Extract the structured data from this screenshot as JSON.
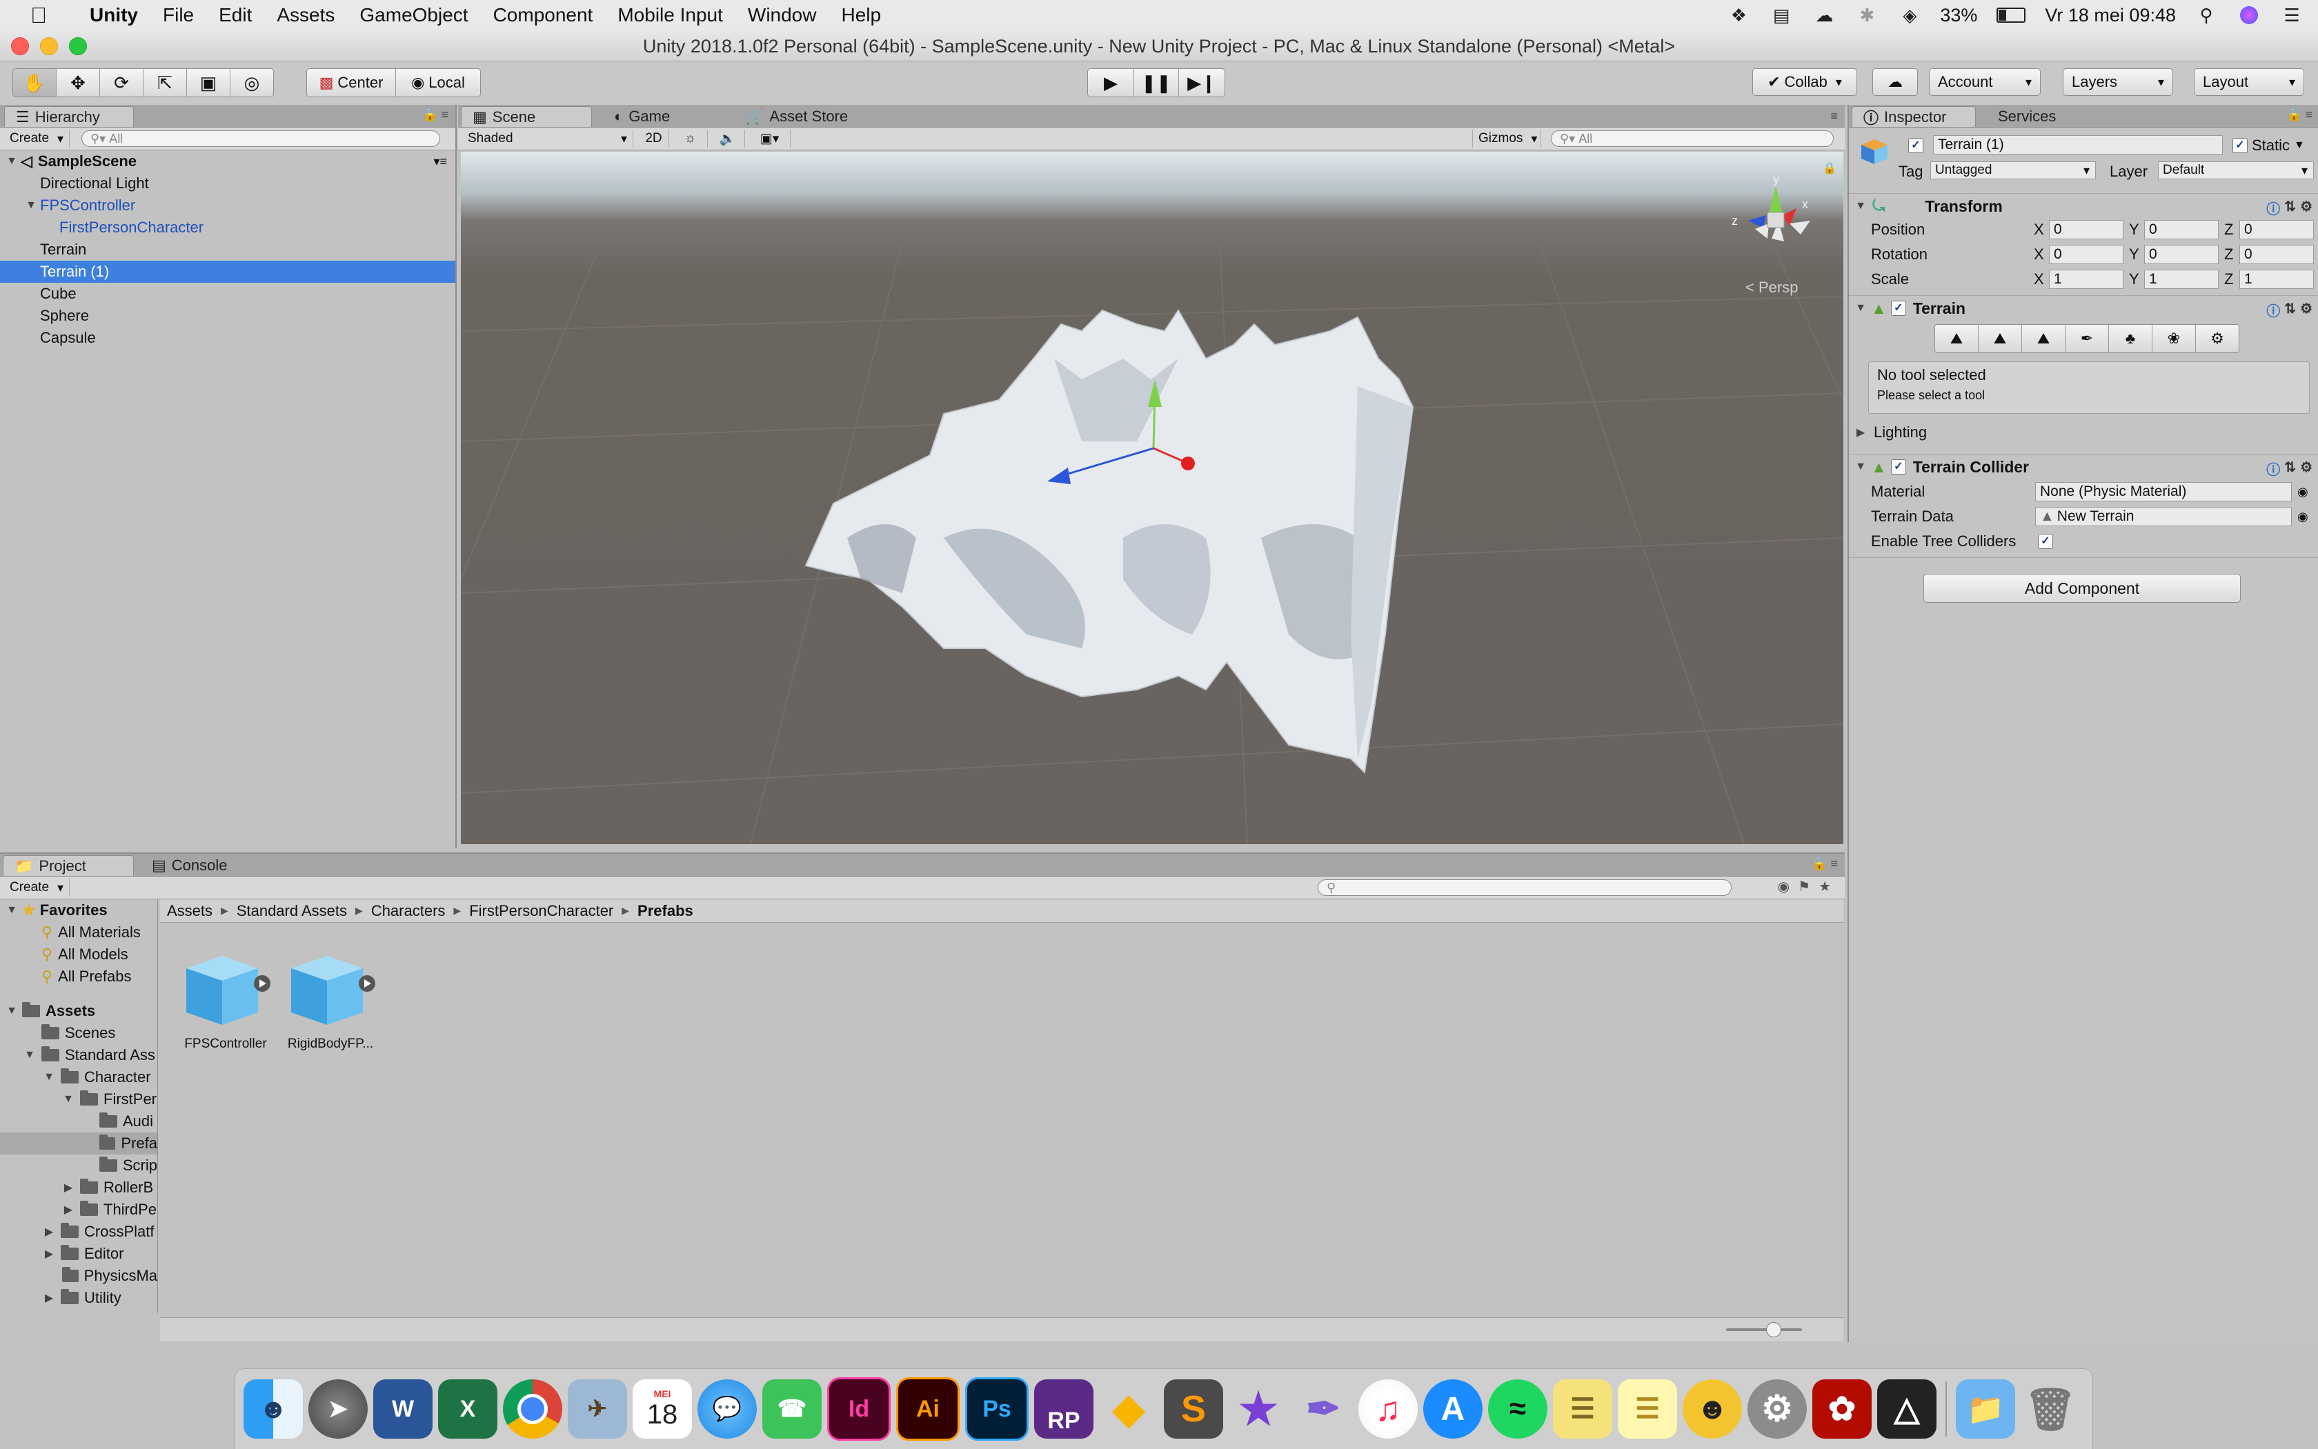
{
  "menubar": {
    "app": "Unity",
    "items": [
      "File",
      "Edit",
      "Assets",
      "GameObject",
      "Component",
      "Mobile Input",
      "Window",
      "Help"
    ],
    "battery": "33%",
    "datetime": "Vr 18 mei  09:48"
  },
  "window": {
    "title": "Unity 2018.1.0f2 Personal (64bit) - SampleScene.unity - New Unity Project - PC, Mac & Linux Standalone (Personal) <Metal>"
  },
  "toolbar": {
    "pivot": "Center",
    "space": "Local",
    "collab": "Collab",
    "account": "Account",
    "layers": "Layers",
    "layout": "Layout"
  },
  "hierarchy": {
    "tab": "Hierarchy",
    "create": "Create",
    "search_placeholder": "All",
    "scene": "SampleScene",
    "items": [
      {
        "label": "Directional Light"
      },
      {
        "label": "FPSController"
      },
      {
        "label": "FirstPersonCharacter"
      },
      {
        "label": "Terrain"
      },
      {
        "label": "Terrain (1)"
      },
      {
        "label": "Cube"
      },
      {
        "label": "Sphere"
      },
      {
        "label": "Capsule"
      }
    ]
  },
  "scene_view": {
    "tabs": [
      "Scene",
      "Game",
      "Asset Store"
    ],
    "shading": "Shaded",
    "mode2d": "2D",
    "gizmos": "Gizmos",
    "search_placeholder": "All",
    "persp": "Persp",
    "axis_labels": [
      "y",
      "x",
      "z"
    ]
  },
  "inspector": {
    "tabs": [
      "Inspector",
      "Services"
    ],
    "object_name": "Terrain (1)",
    "static": "Static",
    "tag_label": "Tag",
    "tag": "Untagged",
    "layer_label": "Layer",
    "layer": "Default",
    "transform": {
      "title": "Transform",
      "position_label": "Position",
      "rotation_label": "Rotation",
      "scale_label": "Scale",
      "position": [
        "0",
        "0",
        "0"
      ],
      "rotation": [
        "0",
        "0",
        "0"
      ],
      "scale": [
        "1",
        "1",
        "1"
      ],
      "axes": [
        "X",
        "Y",
        "Z"
      ]
    },
    "terrain": {
      "title": "Terrain",
      "no_tool": "No tool selected",
      "hint": "Please select a tool",
      "lighting": "Lighting"
    },
    "collider": {
      "title": "Terrain Collider",
      "material_label": "Material",
      "material": "None (Physic Material)",
      "data_label": "Terrain Data",
      "data": "New Terrain",
      "trees_label": "Enable Tree Colliders"
    },
    "add_component": "Add Component"
  },
  "project": {
    "tabs": [
      "Project",
      "Console"
    ],
    "create": "Create",
    "breadcrumb": [
      "Assets",
      "Standard Assets",
      "Characters",
      "FirstPersonCharacter",
      "Prefabs"
    ],
    "favorites": {
      "title": "Favorites",
      "items": [
        "All Materials",
        "All Models",
        "All Prefabs"
      ]
    },
    "tree": [
      {
        "label": "Assets",
        "depth": 0
      },
      {
        "label": "Scenes",
        "depth": 1
      },
      {
        "label": "Standard Ass",
        "depth": 1
      },
      {
        "label": "Character",
        "depth": 2
      },
      {
        "label": "FirstPer",
        "depth": 3
      },
      {
        "label": "Audi",
        "depth": 4
      },
      {
        "label": "Prefa",
        "depth": 4
      },
      {
        "label": "Scrip",
        "depth": 4
      },
      {
        "label": "RollerB",
        "depth": 3
      },
      {
        "label": "ThirdPe",
        "depth": 3
      },
      {
        "label": "CrossPlatf",
        "depth": 2
      },
      {
        "label": "Editor",
        "depth": 2
      },
      {
        "label": "PhysicsMa",
        "depth": 2
      },
      {
        "label": "Utility",
        "depth": 2
      }
    ],
    "assets": [
      "FPSController",
      "RigidBodyFP..."
    ]
  },
  "dock": {
    "items": [
      "Finder",
      "Launchpad",
      "Word",
      "Excel",
      "Chrome",
      "Preview",
      "Calendar",
      "Messages",
      "FaceTime",
      "InDesign",
      "Illustrator",
      "Photoshop",
      "RP",
      "Sketch",
      "Sublime",
      "iMovie",
      "Quill",
      "iTunes",
      "App Store",
      "Spotify",
      "Stickies",
      "Notes",
      "Jitsi",
      "System Preferences",
      "Acrobat",
      "Unity",
      "Downloads",
      "Trash"
    ],
    "calendar_month": "MEI",
    "calendar_day": "18",
    "labels": {
      "word": "W",
      "excel": "X",
      "id": "Id",
      "ai": "Ai",
      "ps": "Ps",
      "rp": "RP"
    }
  },
  "colors": {
    "selection": "#3d80df",
    "scene_ground": "#6b6560",
    "link_blue": "#1d4fb8"
  }
}
